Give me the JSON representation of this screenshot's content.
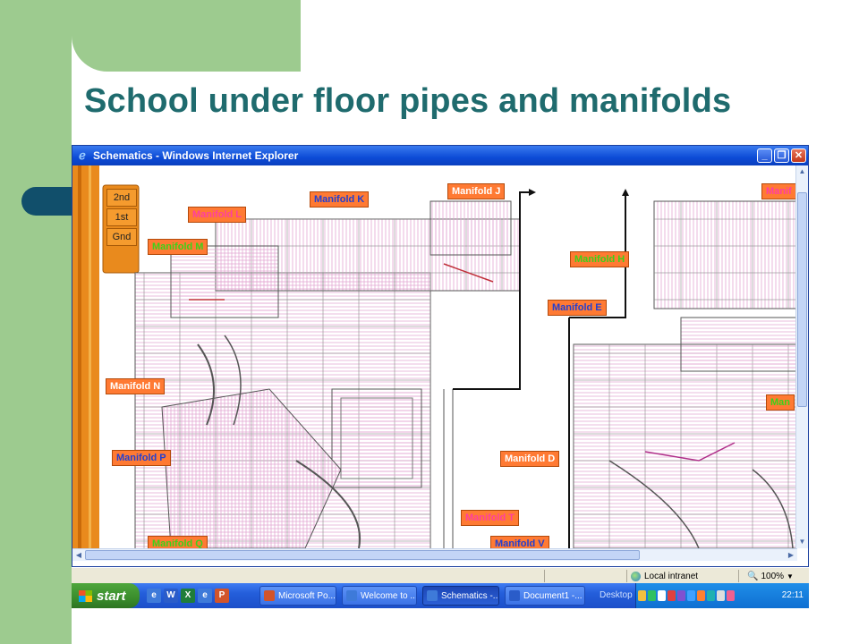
{
  "slide": {
    "title": "School under floor pipes and manifolds"
  },
  "ie": {
    "title": "Schematics - Windows Internet Explorer",
    "buttons": {
      "minimize": "_",
      "maximize": "❐",
      "close": "✕"
    }
  },
  "drawing": {
    "floors": [
      "2nd",
      "1st",
      "Gnd"
    ],
    "manifolds": [
      {
        "label": "Manifold K",
        "style": "blue"
      },
      {
        "label": "Manifold J",
        "style": "orange"
      },
      {
        "label": "Manifold L",
        "style": "pink"
      },
      {
        "label": "Manifold M",
        "style": "green"
      },
      {
        "label": "Manifold H",
        "style": "green"
      },
      {
        "label": "Manifold E",
        "style": "blue"
      },
      {
        "label": "Manifold N",
        "style": "orange"
      },
      {
        "label": "Manifold P",
        "style": "blue"
      },
      {
        "label": "Manifold D",
        "style": "orange"
      },
      {
        "label": "Manifold T",
        "style": "pink"
      },
      {
        "label": "Manifold V",
        "style": "blue"
      },
      {
        "label": "Manifold Q",
        "style": "green"
      },
      {
        "label": "Manif",
        "style": "pink"
      },
      {
        "label": "Man",
        "style": "green"
      }
    ]
  },
  "status": {
    "zone": "Local intranet",
    "zoom": "100%"
  },
  "taskbar": {
    "start": "start",
    "tasks": [
      "Microsoft Po...",
      "Welcome to ...",
      "Schematics -...",
      "Document1 -..."
    ],
    "desktop": "Desktop",
    "clock": "22:11"
  },
  "colors": {
    "green_band": "#9dcb8f",
    "title": "#1f6b6e",
    "bullet": "#114f6b",
    "manifold_orange": "#ff7a33",
    "manifold_pink": "#ff3fa0",
    "manifold_green": "#3dd11a",
    "manifold_blue": "#2340d0",
    "pipe": "#e3a6d2"
  }
}
